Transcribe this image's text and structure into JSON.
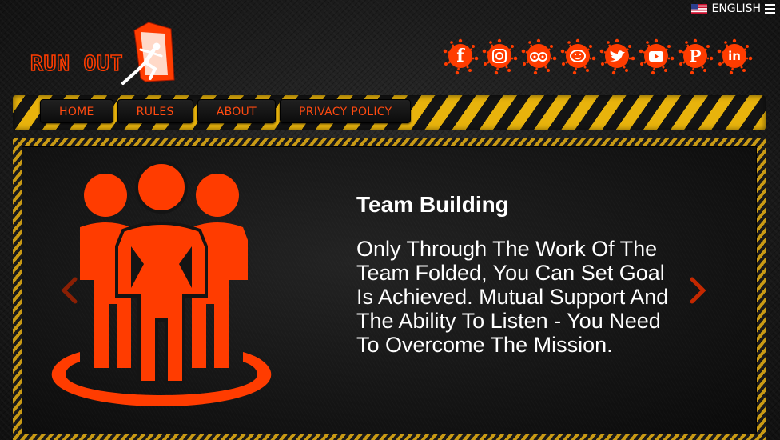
{
  "language": {
    "label": "ENGLISH",
    "flag": "us-flag-icon",
    "menu_icon": "hamburger-icon"
  },
  "logo": {
    "text": "RUN OUT"
  },
  "social": [
    {
      "name": "facebook",
      "glyph": "f"
    },
    {
      "name": "instagram",
      "glyph": "◎"
    },
    {
      "name": "tripadvisor",
      "glyph": "◉◉"
    },
    {
      "name": "waze",
      "glyph": "☺"
    },
    {
      "name": "twitter",
      "glyph": "🐦"
    },
    {
      "name": "youtube",
      "glyph": "▶"
    },
    {
      "name": "pinterest",
      "glyph": "P"
    },
    {
      "name": "linkedin",
      "glyph": "in"
    }
  ],
  "nav": {
    "home": "HOME",
    "rules": "RULES",
    "about": "ABOUT",
    "privacy": "PRIVACY POLICY"
  },
  "slide": {
    "title": "Team Building",
    "text": "Only Through The Work Of The Team Folded, You Can Set Goal Is Achieved. Mutual Support And The Ability To Listen - You Need To Overcome The Mission."
  },
  "colors": {
    "accent": "#ff3c00",
    "nav_text": "#ff4a10",
    "hazard_yellow": "#e8b30c"
  }
}
